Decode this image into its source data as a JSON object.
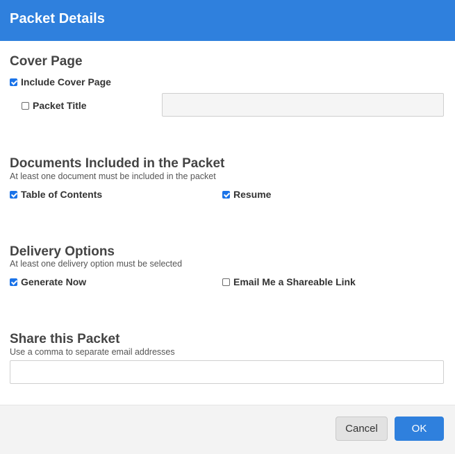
{
  "header": {
    "title": "Packet Details"
  },
  "cover_page": {
    "title": "Cover Page",
    "include_cover_page": {
      "label": "Include Cover Page",
      "checked": true
    },
    "packet_title": {
      "label": "Packet Title",
      "checked": false,
      "value": "",
      "placeholder": ""
    }
  },
  "documents": {
    "title": "Documents Included in the Packet",
    "hint": "At least one document must be included in the packet",
    "table_of_contents": {
      "label": "Table of Contents",
      "checked": true
    },
    "resume": {
      "label": "Resume",
      "checked": true
    }
  },
  "delivery": {
    "title": "Delivery Options",
    "hint": "At least one delivery option must be selected",
    "generate_now": {
      "label": "Generate Now",
      "checked": true
    },
    "email_link": {
      "label": "Email Me a Shareable Link",
      "checked": false
    }
  },
  "share": {
    "title": "Share this Packet",
    "hint": "Use a comma to separate email addresses",
    "emails": {
      "value": "",
      "placeholder": ""
    }
  },
  "footer": {
    "cancel_label": "Cancel",
    "ok_label": "OK"
  },
  "colors": {
    "primary": "#2f80dd",
    "checkbox_checked": "#1a73e8",
    "footer_bg": "#f3f3f3"
  }
}
